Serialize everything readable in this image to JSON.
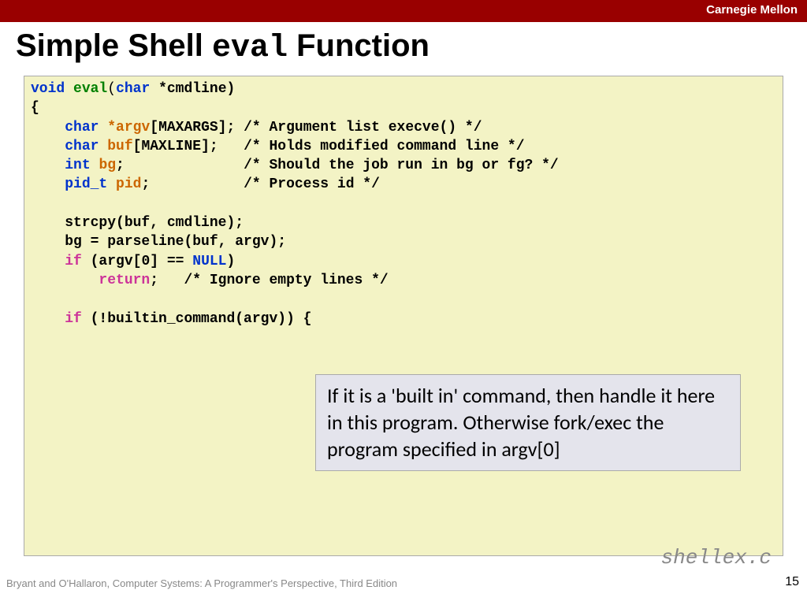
{
  "banner": "Carnegie Mellon",
  "title_pre": "Simple Shell ",
  "title_mono": "eval",
  "title_post": " Function",
  "code": {
    "l1_void": "void",
    "l1_eval": "eval",
    "l1_char": "char",
    "l1_rest": " *cmdline)",
    "l2": "{",
    "l3_char": "char",
    "l3_argv": "*argv",
    "l3_rest": "[MAXARGS]; /* Argument list execve() */",
    "l4_char": "char",
    "l4_buf": "buf",
    "l4_rest": "[MAXLINE];   /* Holds modified command line */",
    "l5_int": "int",
    "l5_bg": "bg",
    "l5_rest": ";              /* Should the job run in bg or fg? */",
    "l6_pidt": "pid_t",
    "l6_pid": "pid",
    "l6_rest": ";           /* Process id */",
    "l8": "strcpy(buf, cmdline);",
    "l9": "bg = parseline(buf, argv);",
    "l10_if": "if",
    "l10_rest": " (argv[0] == ",
    "l10_null": "NULL",
    "l10_end": ")",
    "l11_return": "return",
    "l11_rest": ";   /* Ignore empty lines */",
    "l13_if": "if",
    "l13_rest": " (!builtin_command(argv)) {",
    "indent1": "    ",
    "indent2": "        "
  },
  "callout": "If it is a 'built in' command, then handle it here in this program. Otherwise fork/exec the program specified in argv[0]",
  "filename": "shellex.c",
  "pagenum": "15",
  "footer": "Bryant and O'Hallaron, Computer Systems: A Programmer's Perspective, Third Edition"
}
